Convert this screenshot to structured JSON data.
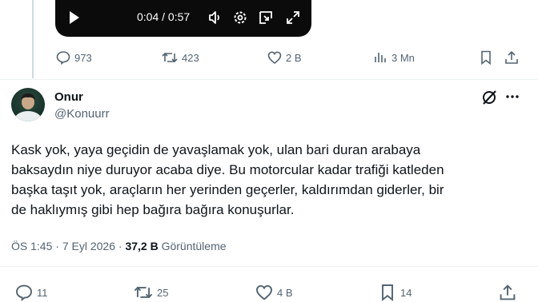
{
  "video": {
    "time": "0:04 / 0:57"
  },
  "top_actions": {
    "replies": "973",
    "reposts": "423",
    "likes": "2 B",
    "views": "3 Mn"
  },
  "tweet": {
    "display_name": "Onur",
    "handle": "@Konuurr",
    "text": "Kask yok, yaya geçidin de yavaşlamak yok, ulan bari duran arabaya\nbaksaydın niye duruyor acaba diye. Bu motorcular kadar trafiği katleden\nbaşka taşıt yok, araçların her yerinden geçerler, kaldırımdan giderler, bir\nde haklıymış gibi hep bağıra bağıra konuşurlar.",
    "time": "ÖS 1:45",
    "separator": "·",
    "date": "7 Eyl 2026",
    "views_count": "37,2 B",
    "views_label": "Görüntüleme"
  },
  "bottom_actions": {
    "replies": "11",
    "reposts": "25",
    "likes": "4 B",
    "bookmarks": "14"
  },
  "colors": {
    "icon_gray": "#536471",
    "text": "#0f1419",
    "divider": "#eff3f4",
    "video_bg": "#0b0b0b"
  }
}
